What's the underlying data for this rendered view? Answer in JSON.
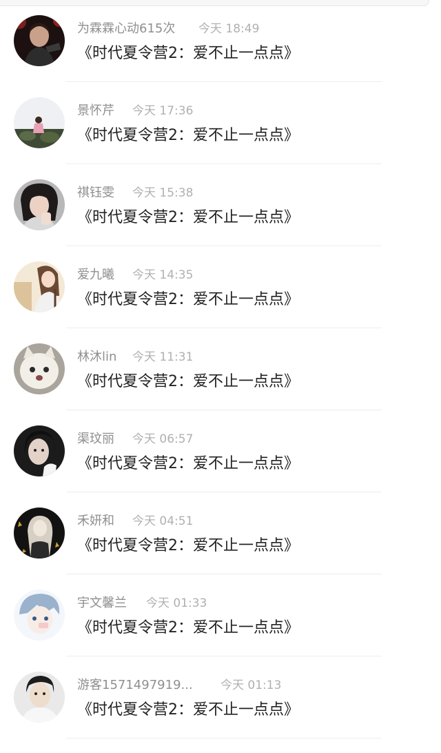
{
  "comments": [
    {
      "user": "为霖霖心动615次",
      "time": "今天 18:49",
      "text": "《时代夏令营2：爱不止一点点》",
      "avatar": "avatar-dark-performer"
    },
    {
      "user": "景怀芹",
      "time": "今天 17:36",
      "text": "《时代夏令营2：爱不止一点点》",
      "avatar": "avatar-girl-in-field"
    },
    {
      "user": "祺钰雯",
      "time": "今天 15:38",
      "text": "《时代夏令营2：爱不止一点点》",
      "avatar": "avatar-girl-portrait"
    },
    {
      "user": "爱九曦",
      "time": "今天 14:35",
      "text": "《时代夏令营2：爱不止一点点》",
      "avatar": "avatar-illustrated-girl"
    },
    {
      "user": "林沐lin",
      "time": "今天 11:31",
      "text": "《时代夏令营2：爱不止一点点》",
      "avatar": "avatar-white-cat"
    },
    {
      "user": "渠玟丽",
      "time": "今天 06:57",
      "text": "《时代夏令营2：爱不止一点点》",
      "avatar": "avatar-dark-haired-girl"
    },
    {
      "user": "禾妍和",
      "time": "今天 04:51",
      "text": "《时代夏令营2：爱不止一点点》",
      "avatar": "avatar-anime-dark"
    },
    {
      "user": "宇文馨兰",
      "time": "今天 01:33",
      "text": "《时代夏令营2：爱不止一点点》",
      "avatar": "avatar-anime-boy"
    },
    {
      "user": "游客1571497919...",
      "time": "今天 01:13",
      "text": "《时代夏令营2：爱不止一点点》",
      "avatar": "avatar-young-man"
    }
  ]
}
